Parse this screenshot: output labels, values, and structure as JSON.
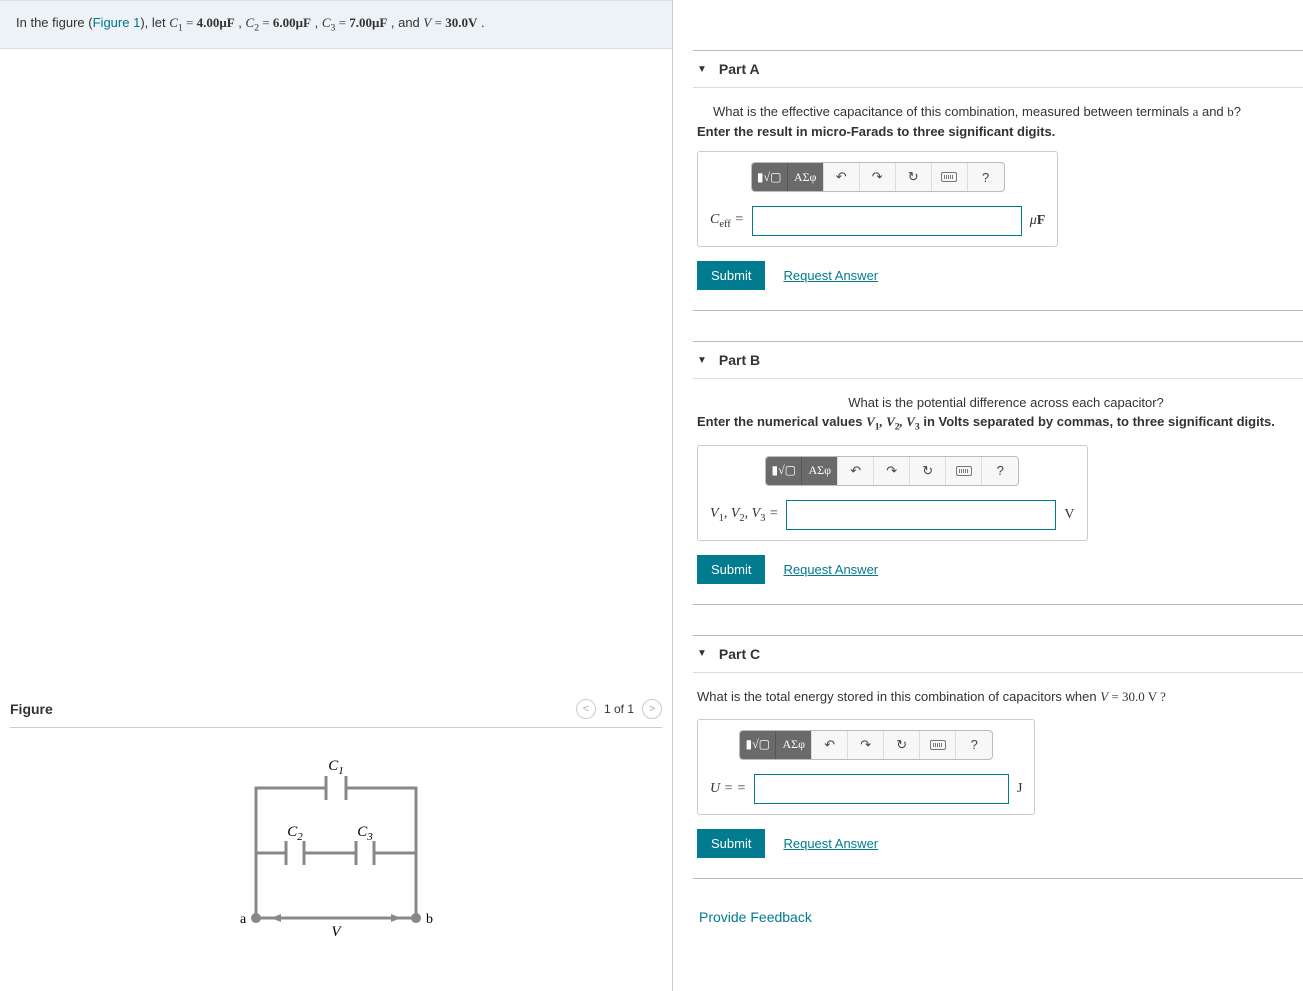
{
  "problem": {
    "prefix": "In the figure (",
    "figure_link": "Figure 1",
    "suffix": "), let ",
    "c1_label": "C",
    "c1_sub": "1",
    "eq": " = ",
    "c1_val": "4.00μF",
    "c2_label": "C",
    "c2_sub": "2",
    "c2_val": "6.00μF",
    "c3_label": "C",
    "c3_sub": "3",
    "c3_val": "7.00μF",
    "v_label": "V",
    "v_val": "30.0V",
    "sep": " , ",
    "and": " , and ",
    "period": " ."
  },
  "figure": {
    "title": "Figure",
    "pager": "1 of 1",
    "labels": {
      "c1": "C",
      "c1s": "1",
      "c2": "C",
      "c2s": "2",
      "c3": "C",
      "c3s": "3",
      "a": "a",
      "b": "b",
      "v": "V"
    }
  },
  "toolbar": {
    "tmpl_icon": "▮√▢",
    "greek": "ΑΣφ",
    "undo": "↶",
    "redo": "↷",
    "reset": "↻",
    "help": "?"
  },
  "partA": {
    "title": "Part A",
    "question_html": "What is the effective capacitance of this combination, measured between terminals a and b?",
    "instruction": "Enter the result in micro-Farads to three significant digits.",
    "label_base": "C",
    "label_sub": "eff",
    "label_eq": " =",
    "unit": "μF",
    "submit": "Submit",
    "request": "Request Answer"
  },
  "partB": {
    "title": "Part B",
    "question": "What is the potential difference across each capacitor?",
    "instruction_pre": "Enter the numerical values  ",
    "instruction_vars": "V₁, V₂, V₃",
    "instruction_post": " in Volts separated by commas, to three significant digits.",
    "label": "V₁, V₂, V₃ =",
    "unit": "V",
    "submit": "Submit",
    "request": "Request Answer"
  },
  "partC": {
    "title": "Part C",
    "question_pre": "What is the total energy stored in this combination of capacitors when ",
    "question_var": "V",
    "question_val": " = 30.0 V ?",
    "label": "U = =",
    "unit": "J",
    "submit": "Submit",
    "request": "Request Answer"
  },
  "feedback": "Provide Feedback"
}
